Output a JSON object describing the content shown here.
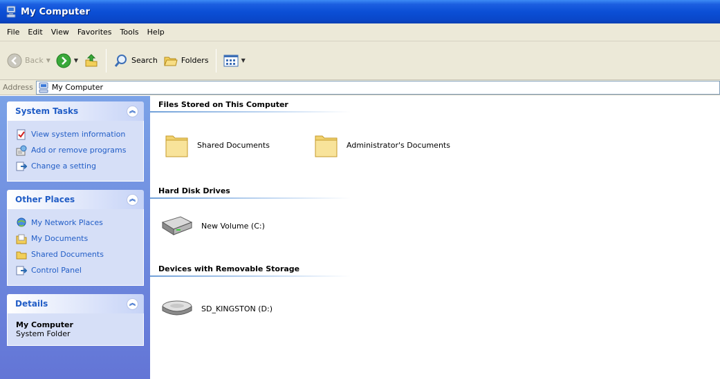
{
  "window": {
    "title": "My Computer"
  },
  "menu": [
    "File",
    "Edit",
    "View",
    "Favorites",
    "Tools",
    "Help"
  ],
  "toolbar": {
    "back": "Back",
    "search": "Search",
    "folders": "Folders"
  },
  "address": {
    "label": "Address",
    "value": "My Computer"
  },
  "sidebar": {
    "system_tasks": {
      "title": "System Tasks",
      "items": [
        {
          "label": "View system information",
          "icon": "system-info-icon"
        },
        {
          "label": "Add or remove programs",
          "icon": "add-remove-icon"
        },
        {
          "label": "Change a setting",
          "icon": "control-panel-icon"
        }
      ]
    },
    "other_places": {
      "title": "Other Places",
      "items": [
        {
          "label": "My Network Places",
          "icon": "network-places-icon"
        },
        {
          "label": "My Documents",
          "icon": "my-documents-icon"
        },
        {
          "label": "Shared Documents",
          "icon": "folder-icon"
        },
        {
          "label": "Control Panel",
          "icon": "control-panel-icon"
        }
      ]
    },
    "details": {
      "title": "Details",
      "name": "My Computer",
      "type": "System Folder"
    }
  },
  "content": {
    "groups": [
      {
        "title": "Files Stored on This Computer",
        "items": [
          "Shared Documents",
          "Administrator's Documents"
        ]
      },
      {
        "title": "Hard Disk Drives",
        "items": [
          "New Volume (C:)"
        ]
      },
      {
        "title": "Devices with Removable Storage",
        "items": [
          "SD_KINGSTON (D:)"
        ]
      }
    ]
  },
  "colors": {
    "titlebar": "#0a4fd6",
    "task_link": "#215dc6",
    "panel_body": "#d6dff7",
    "pane_bg": "#6f8fe0"
  }
}
